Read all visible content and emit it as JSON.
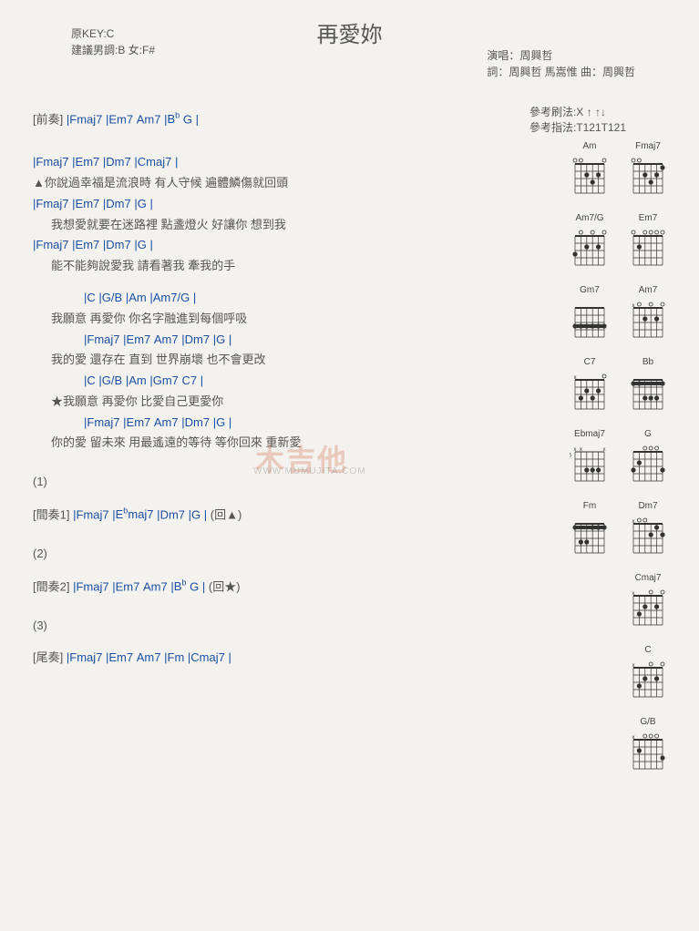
{
  "title": "再愛妳",
  "key_info": {
    "line1": "原KEY:C",
    "line2": "建議男調:B  女:F#"
  },
  "credits": {
    "line1": "演唱：周興哲",
    "line2": "詞：周興哲 馬嵩惟   曲：周興哲"
  },
  "pattern": {
    "line1": "參考刷法:X ↑ ↑↓",
    "line2": "參考指法:T121T121"
  },
  "watermark": "木吉他",
  "watermark_sub": "WWW.MUMUJITA.COM",
  "lines": [
    {
      "type": "chordline",
      "cls": "",
      "html": "[前奏] |Fmaj7   |Em7   Am7   |B<sup>b</sup>   G  |"
    },
    {
      "type": "spacer"
    },
    {
      "type": "chordline",
      "cls": "gap",
      "html": "|Fmaj7                    |Em7              |Dm7                    |Cmaj7     |"
    },
    {
      "type": "lyric",
      "cls": "",
      "text": "▲你說過幸福是流浪時   有人守候   遍體鱗傷就回頭"
    },
    {
      "type": "chordline",
      "cls": "",
      "html": "|Fmaj7                    |Em7              |Dm7                    |G           |"
    },
    {
      "type": "lyric",
      "cls": "pad20",
      "text": "我想愛就要在迷路裡   點盞燈火   好讓你   想到我"
    },
    {
      "type": "chordline",
      "cls": "",
      "html": "|Fmaj7                |Em7        |Dm7    |G       |"
    },
    {
      "type": "lyric",
      "cls": "pad20",
      "text": "能不能夠說愛我   請看著我   牽我的手"
    },
    {
      "type": "chordline",
      "cls": "gap pad56",
      "html": "|C           |G/B          |Am               |Am7/G       |"
    },
    {
      "type": "lyric",
      "cls": "pad20",
      "text": "我願意   再愛你   你名字融進到每個呼吸"
    },
    {
      "type": "chordline",
      "cls": "pad56",
      "html": "|Fmaj7    |Em7   Am7  |Dm7             |G               |"
    },
    {
      "type": "lyric",
      "cls": "pad20",
      "text": "我的愛   還存在   直到     世界崩壞   也不會更改"
    },
    {
      "type": "chordline",
      "cls": "pad56",
      "html": "|C           |G/B          |Am         |Gm7   C7   |"
    },
    {
      "type": "lyric",
      "cls": "pad20",
      "text": "★我願意   再愛你   比愛自己更愛你"
    },
    {
      "type": "chordline",
      "cls": "pad56",
      "html": "|Fmaj7    |Em7   Am7    |Dm7               |G           |"
    },
    {
      "type": "lyric",
      "cls": "pad20",
      "text": "你的愛   留未來     用最遙遠的等待   等你回來   重新愛"
    },
    {
      "type": "plain",
      "cls": "gap-lg",
      "text": "(1)"
    },
    {
      "type": "chordline",
      "cls": "gap",
      "html": "[間奏1] |Fmaj7   |E<sup>b</sup>maj7   |Dm7   |G   |   (回▲)"
    },
    {
      "type": "plain",
      "cls": "gap-lg",
      "text": "(2)"
    },
    {
      "type": "chordline",
      "cls": "gap",
      "html": "[間奏2] |Fmaj7   |Em7   Am7     |B<sup>b</sup>   G  |   (回★)"
    },
    {
      "type": "plain",
      "cls": "gap-lg",
      "text": "(3)"
    },
    {
      "type": "chordline",
      "cls": "gap",
      "html": "[尾奏] |Fmaj7   |Em7   Am7   |Fm   |Cmaj7   |"
    }
  ],
  "chord_diagrams": [
    [
      {
        "name": "Am",
        "dots": [
          [
            1,
            2
          ],
          [
            2,
            3
          ],
          [
            3,
            2
          ]
        ],
        "open": [
          0,
          4,
          5
        ],
        "mute": []
      },
      {
        "name": "Fmaj7",
        "dots": [
          [
            0,
            1
          ],
          [
            1,
            2
          ],
          [
            2,
            3
          ],
          [
            3,
            2
          ]
        ],
        "open": [
          4,
          5
        ],
        "mute": []
      }
    ],
    [
      {
        "name": "Am7/G",
        "dots": [
          [
            1,
            2
          ],
          [
            3,
            2
          ],
          [
            5,
            3
          ]
        ],
        "open": [
          0,
          2,
          4
        ],
        "mute": []
      },
      {
        "name": "Em7",
        "dots": [
          [
            4,
            2
          ]
        ],
        "open": [
          0,
          1,
          2,
          3,
          5
        ],
        "mute": []
      }
    ],
    [
      {
        "name": "Gm7",
        "dots": [
          [
            0,
            3
          ],
          [
            1,
            3
          ],
          [
            2,
            3
          ],
          [
            3,
            3
          ],
          [
            4,
            3
          ],
          [
            5,
            3
          ]
        ],
        "barre": 3,
        "open": [],
        "mute": []
      },
      {
        "name": "Am7",
        "dots": [
          [
            1,
            2
          ],
          [
            3,
            2
          ]
        ],
        "open": [
          0,
          2,
          4
        ],
        "mute": [
          5
        ]
      }
    ],
    [
      {
        "name": "C7",
        "dots": [
          [
            1,
            2
          ],
          [
            2,
            3
          ],
          [
            3,
            2
          ],
          [
            4,
            3
          ]
        ],
        "open": [
          0
        ],
        "mute": [
          5
        ]
      },
      {
        "name": "Bb",
        "dots": [
          [
            0,
            1
          ],
          [
            1,
            3
          ],
          [
            2,
            3
          ],
          [
            3,
            3
          ],
          [
            4,
            1
          ],
          [
            5,
            1
          ]
        ],
        "barre": 1,
        "open": [],
        "mute": []
      }
    ],
    [
      {
        "name": "Ebmaj7",
        "dots": [
          [
            1,
            3
          ],
          [
            2,
            3
          ],
          [
            3,
            3
          ]
        ],
        "open": [],
        "mute": [
          0,
          4,
          5
        ],
        "fret": 6
      },
      {
        "name": "G",
        "dots": [
          [
            0,
            3
          ],
          [
            4,
            2
          ],
          [
            5,
            3
          ]
        ],
        "open": [
          1,
          2,
          3
        ],
        "mute": []
      }
    ],
    [
      {
        "name": "Fm",
        "dots": [
          [
            0,
            1
          ],
          [
            1,
            1
          ],
          [
            2,
            1
          ],
          [
            3,
            3
          ],
          [
            4,
            3
          ],
          [
            5,
            1
          ]
        ],
        "barre": 1,
        "open": [],
        "mute": []
      },
      {
        "name": "Dm7",
        "dots": [
          [
            0,
            2
          ],
          [
            1,
            1
          ],
          [
            2,
            2
          ]
        ],
        "open": [
          3,
          4
        ],
        "mute": [
          5
        ]
      }
    ],
    [
      null,
      {
        "name": "Cmaj7",
        "dots": [
          [
            1,
            2
          ],
          [
            3,
            2
          ],
          [
            4,
            3
          ]
        ],
        "open": [
          0,
          2
        ],
        "mute": [
          5
        ]
      }
    ],
    [
      null,
      {
        "name": "C",
        "dots": [
          [
            1,
            2
          ],
          [
            3,
            2
          ],
          [
            4,
            3
          ]
        ],
        "open": [
          0,
          2
        ],
        "mute": [
          5
        ]
      }
    ],
    [
      null,
      {
        "name": "G/B",
        "dots": [
          [
            0,
            3
          ],
          [
            4,
            2
          ]
        ],
        "open": [
          1,
          2,
          3
        ],
        "mute": [
          5
        ]
      }
    ]
  ]
}
